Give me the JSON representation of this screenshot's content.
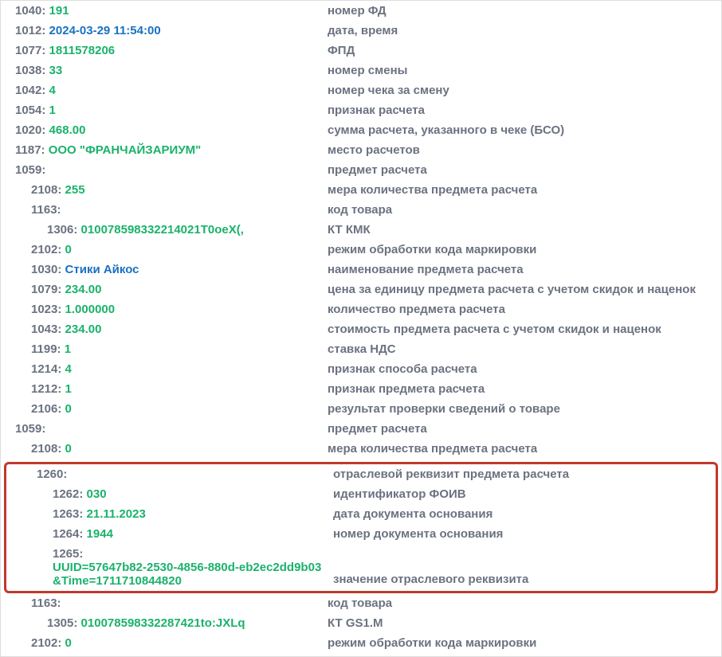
{
  "rows_top": [
    {
      "indent": 0,
      "tag": "1040",
      "val": "191",
      "cls": "val-green",
      "desc": "номер ФД"
    },
    {
      "indent": 0,
      "tag": "1012",
      "val": "2024-03-29 11:54:00",
      "cls": "val-blue",
      "desc": "дата, время"
    },
    {
      "indent": 0,
      "tag": "1077",
      "val": "1811578206",
      "cls": "val-green",
      "desc": "ФПД"
    },
    {
      "indent": 0,
      "tag": "1038",
      "val": "33",
      "cls": "val-green",
      "desc": "номер смены"
    },
    {
      "indent": 0,
      "tag": "1042",
      "val": "4",
      "cls": "val-green",
      "desc": "номер чека за смену"
    },
    {
      "indent": 0,
      "tag": "1054",
      "val": "1",
      "cls": "val-green",
      "desc": "признак расчета"
    },
    {
      "indent": 0,
      "tag": "1020",
      "val": "468.00",
      "cls": "val-green",
      "desc": "сумма расчета, указанного в чеке (БСО)"
    },
    {
      "indent": 0,
      "tag": "1187",
      "val": "ООО \"ФРАНЧАЙЗАРИУМ\"",
      "cls": "val-green",
      "desc": "место расчетов"
    },
    {
      "indent": 0,
      "tag": "1059",
      "val": "",
      "cls": "",
      "desc": "предмет расчета"
    },
    {
      "indent": 1,
      "tag": "2108",
      "val": "255",
      "cls": "val-green",
      "desc": "мера количества предмета расчета"
    },
    {
      "indent": 1,
      "tag": "1163",
      "val": "",
      "cls": "",
      "desc": "код товара"
    },
    {
      "indent": 2,
      "tag": "1306",
      "val": "010078598332214021T0oeX(,",
      "cls": "val-green",
      "desc": "КТ КМК"
    },
    {
      "indent": 1,
      "tag": "2102",
      "val": "0",
      "cls": "val-green",
      "desc": "режим обработки кода маркировки"
    },
    {
      "indent": 1,
      "tag": "1030",
      "val": "Стики Айкос",
      "cls": "val-blue",
      "desc": "наименование предмета расчета"
    },
    {
      "indent": 1,
      "tag": "1079",
      "val": "234.00",
      "cls": "val-green",
      "desc": "цена за единицу предмета расчета с учетом скидок и наценок"
    },
    {
      "indent": 1,
      "tag": "1023",
      "val": "1.000000",
      "cls": "val-green",
      "desc": "количество предмета расчета"
    },
    {
      "indent": 1,
      "tag": "1043",
      "val": "234.00",
      "cls": "val-green",
      "desc": "стоимость предмета расчета с учетом скидок и наценок"
    },
    {
      "indent": 1,
      "tag": "1199",
      "val": "1",
      "cls": "val-green",
      "desc": "ставка НДС"
    },
    {
      "indent": 1,
      "tag": "1214",
      "val": "4",
      "cls": "val-green",
      "desc": "признак способа расчета"
    },
    {
      "indent": 1,
      "tag": "1212",
      "val": "1",
      "cls": "val-green",
      "desc": "признак предмета расчета"
    },
    {
      "indent": 1,
      "tag": "2106",
      "val": "0",
      "cls": "val-green",
      "desc": "результат проверки сведений о товаре"
    },
    {
      "indent": 0,
      "tag": "1059",
      "val": "",
      "cls": "",
      "desc": "предмет расчета"
    },
    {
      "indent": 1,
      "tag": "2108",
      "val": "0",
      "cls": "val-green",
      "desc": "мера количества предмета расчета"
    }
  ],
  "rows_box": [
    {
      "indent": 1,
      "tag": "1260",
      "val": "",
      "cls": "",
      "desc": "отраслевой реквизит предмета расчета"
    },
    {
      "indent": 2,
      "tag": "1262",
      "val": "030",
      "cls": "val-green",
      "desc": "идентификатор ФОИВ"
    },
    {
      "indent": 2,
      "tag": "1263",
      "val": "21.11.2023",
      "cls": "val-green",
      "desc": "дата документа основания"
    },
    {
      "indent": 2,
      "tag": "1264",
      "val": "1944",
      "cls": "val-green",
      "desc": "номер документа основания"
    },
    {
      "indent": 2,
      "tag": "1265",
      "val": "UUID=57647b82-2530-4856-880d-eb2ec2dd9b03&Time=1711710844820",
      "cls": "val-green",
      "desc": "значение отраслевого реквизита",
      "wrap": true
    }
  ],
  "rows_bottom": [
    {
      "indent": 1,
      "tag": "1163",
      "val": "",
      "cls": "",
      "desc": "код товара"
    },
    {
      "indent": 2,
      "tag": "1305",
      "val": "010078598332287421to:JXLq",
      "cls": "val-green",
      "desc": "КТ GS1.M"
    },
    {
      "indent": 1,
      "tag": "2102",
      "val": "0",
      "cls": "val-green",
      "desc": "режим обработки кода маркировки"
    }
  ]
}
